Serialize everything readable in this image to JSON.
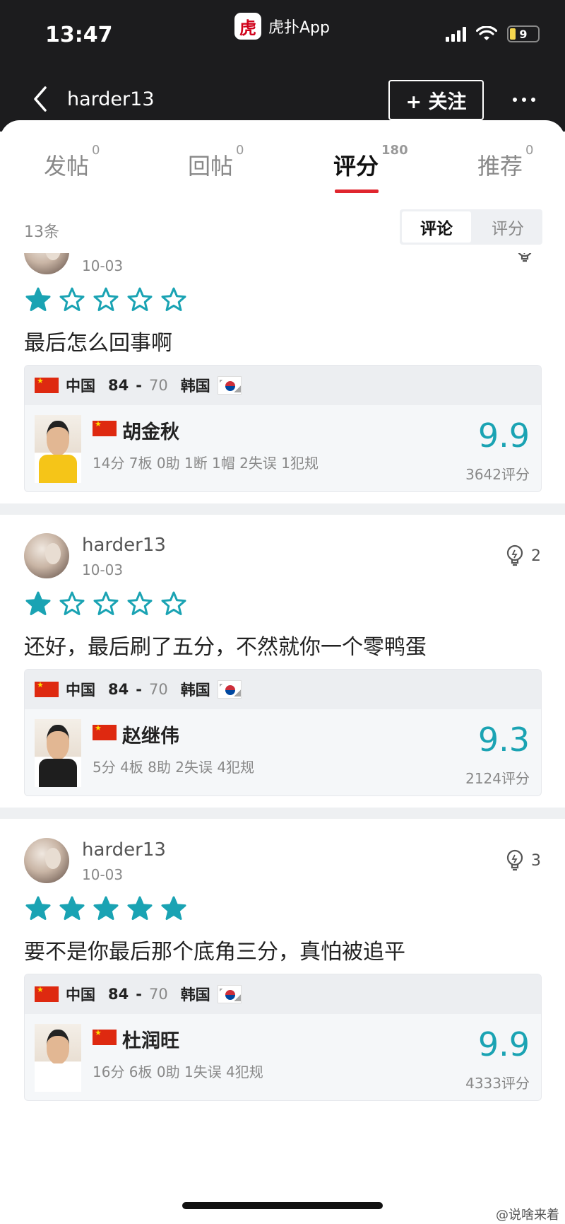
{
  "status": {
    "time": "13:47",
    "app_name": "虎扑App",
    "app_logo_char": "虎",
    "battery": "9"
  },
  "nav": {
    "title": "harder13",
    "follow_label": "+ 关注"
  },
  "tabs": [
    {
      "label": "发帖",
      "count": "0"
    },
    {
      "label": "回帖",
      "count": "0"
    },
    {
      "label": "评分",
      "count": "180"
    },
    {
      "label": "推荐",
      "count": "0"
    }
  ],
  "subbar": {
    "count": "13条",
    "seg": [
      "评论",
      "评分"
    ]
  },
  "colors": {
    "accent": "#e0262e",
    "star": "#1aa3b3",
    "score": "#1aa3b3"
  },
  "posts": [
    {
      "user": "",
      "date": "10-03",
      "likes": "",
      "rating": 1,
      "comment": "最后怎么回事啊",
      "game": {
        "home": "中国",
        "home_score": "84",
        "away_score": "70",
        "away": "韩国"
      },
      "player": {
        "name": "胡金秋",
        "stats": "14分 7板 0助 1断 1帽 2失误 1犯规",
        "score": "9.9",
        "count": "3642评分"
      }
    },
    {
      "user": "harder13",
      "date": "10-03",
      "likes": "2",
      "rating": 1,
      "comment": "还好，最后刷了五分，不然就你一个零鸭蛋",
      "game": {
        "home": "中国",
        "home_score": "84",
        "away_score": "70",
        "away": "韩国"
      },
      "player": {
        "name": "赵继伟",
        "stats": "5分 4板 8助 2失误 4犯规",
        "score": "9.3",
        "count": "2124评分"
      }
    },
    {
      "user": "harder13",
      "date": "10-03",
      "likes": "3",
      "rating": 5,
      "comment": "要不是你最后那个底角三分，真怕被追平",
      "game": {
        "home": "中国",
        "home_score": "84",
        "away_score": "70",
        "away": "韩国"
      },
      "player": {
        "name": "杜润旺",
        "stats": "16分 6板 0助 1失误 4犯规",
        "score": "9.9",
        "count": "4333评分"
      }
    }
  ],
  "watermark": "@说啥来着"
}
